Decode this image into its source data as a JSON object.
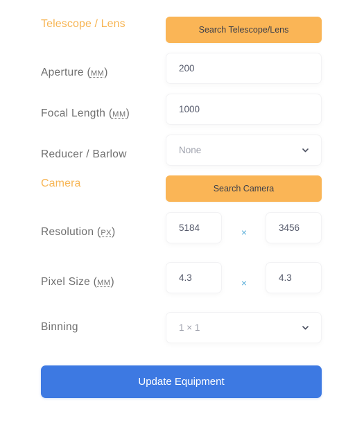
{
  "telescope": {
    "section_title": "Telescope / Lens",
    "search_button": "Search Telescope/Lens",
    "aperture": {
      "label": "Aperture",
      "unit": "mm",
      "value": "200"
    },
    "focal_length": {
      "label": "Focal Length",
      "unit": "mm",
      "value": "1000"
    },
    "reducer": {
      "label": "Reducer / Barlow",
      "selected": "None"
    }
  },
  "camera": {
    "section_title": "Camera",
    "search_button": "Search Camera",
    "resolution": {
      "label": "Resolution",
      "unit": "px",
      "width": "5184",
      "height": "3456",
      "separator": "×"
    },
    "pixel_size": {
      "label": "Pixel Size",
      "unit": "mm",
      "width": "4.3",
      "height": "4.3",
      "separator": "×"
    },
    "binning": {
      "label": "Binning",
      "selected": "1 × 1"
    }
  },
  "actions": {
    "update_button": "Update Equipment"
  },
  "colors": {
    "accent_orange": "#fab556",
    "section_orange": "#f7b554",
    "primary_blue": "#3d79e2",
    "separator_blue": "#5aaed9"
  }
}
